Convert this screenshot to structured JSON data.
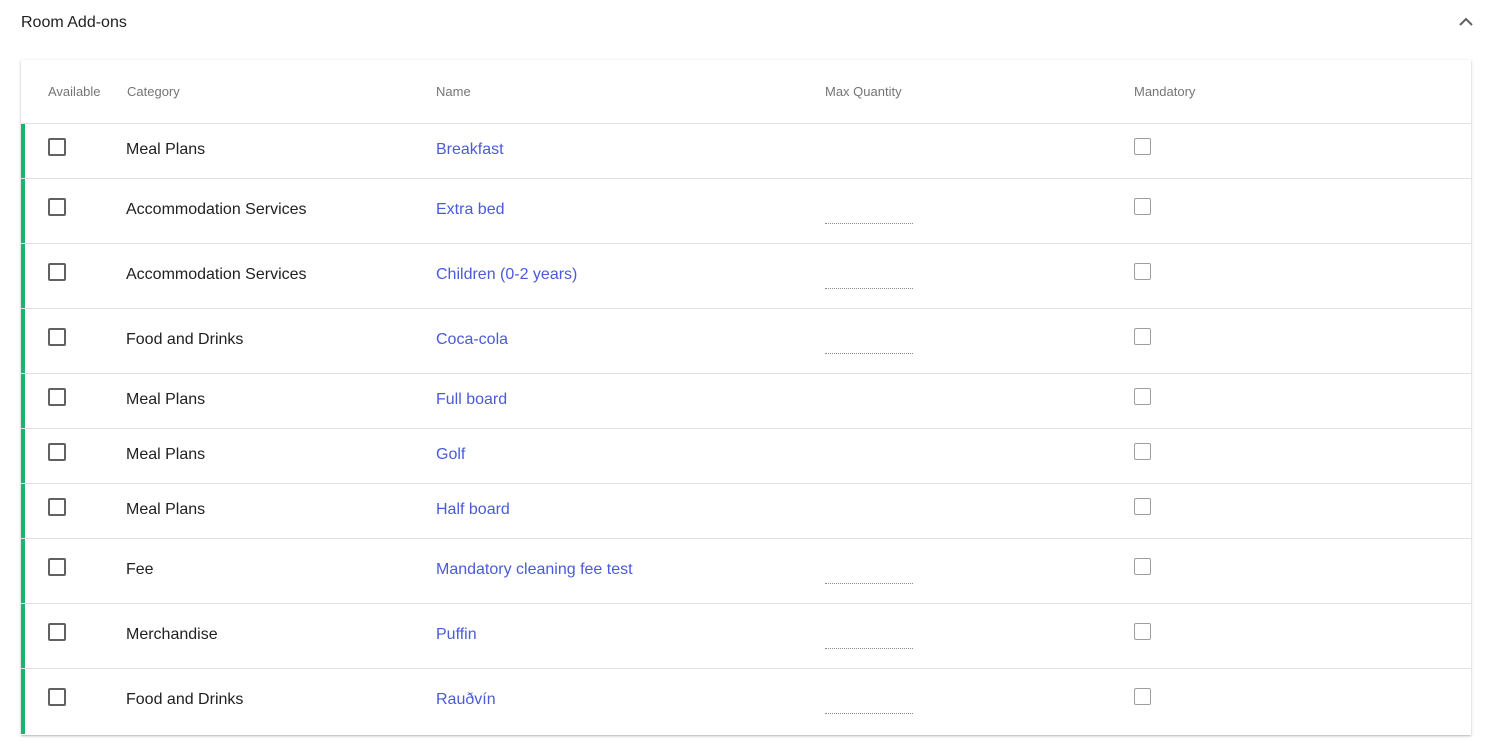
{
  "section": {
    "title": "Room Add-ons",
    "toggle_icon": "chevron-up-icon"
  },
  "columns": {
    "available": "Available",
    "category": "Category",
    "name": "Name",
    "max_quantity": "Max Quantity",
    "mandatory": "Mandatory"
  },
  "colors": {
    "accent_bar": "#19b46d",
    "link": "#4a5bd9"
  },
  "rows": [
    {
      "category": "Meal Plans",
      "name": "Breakfast",
      "max_quantity": "",
      "has_qty": false,
      "available": false,
      "mandatory": false
    },
    {
      "category": "Accommodation Services",
      "name": "Extra bed",
      "max_quantity": "",
      "has_qty": true,
      "available": false,
      "mandatory": false
    },
    {
      "category": "Accommodation Services",
      "name": "Children (0-2 years)",
      "max_quantity": "",
      "has_qty": true,
      "available": false,
      "mandatory": false
    },
    {
      "category": "Food and Drinks",
      "name": "Coca-cola",
      "max_quantity": "",
      "has_qty": true,
      "available": false,
      "mandatory": false
    },
    {
      "category": "Meal Plans",
      "name": "Full board",
      "max_quantity": "",
      "has_qty": false,
      "available": false,
      "mandatory": false
    },
    {
      "category": "Meal Plans",
      "name": "Golf",
      "max_quantity": "",
      "has_qty": false,
      "available": false,
      "mandatory": false
    },
    {
      "category": "Meal Plans",
      "name": "Half board",
      "max_quantity": "",
      "has_qty": false,
      "available": false,
      "mandatory": false
    },
    {
      "category": "Fee",
      "name": "Mandatory cleaning fee test",
      "max_quantity": "",
      "has_qty": true,
      "available": false,
      "mandatory": false
    },
    {
      "category": "Merchandise",
      "name": "Puffin",
      "max_quantity": "",
      "has_qty": true,
      "available": false,
      "mandatory": false
    },
    {
      "category": "Food and Drinks",
      "name": "Rauðvín",
      "max_quantity": "",
      "has_qty": true,
      "available": false,
      "mandatory": false
    }
  ]
}
